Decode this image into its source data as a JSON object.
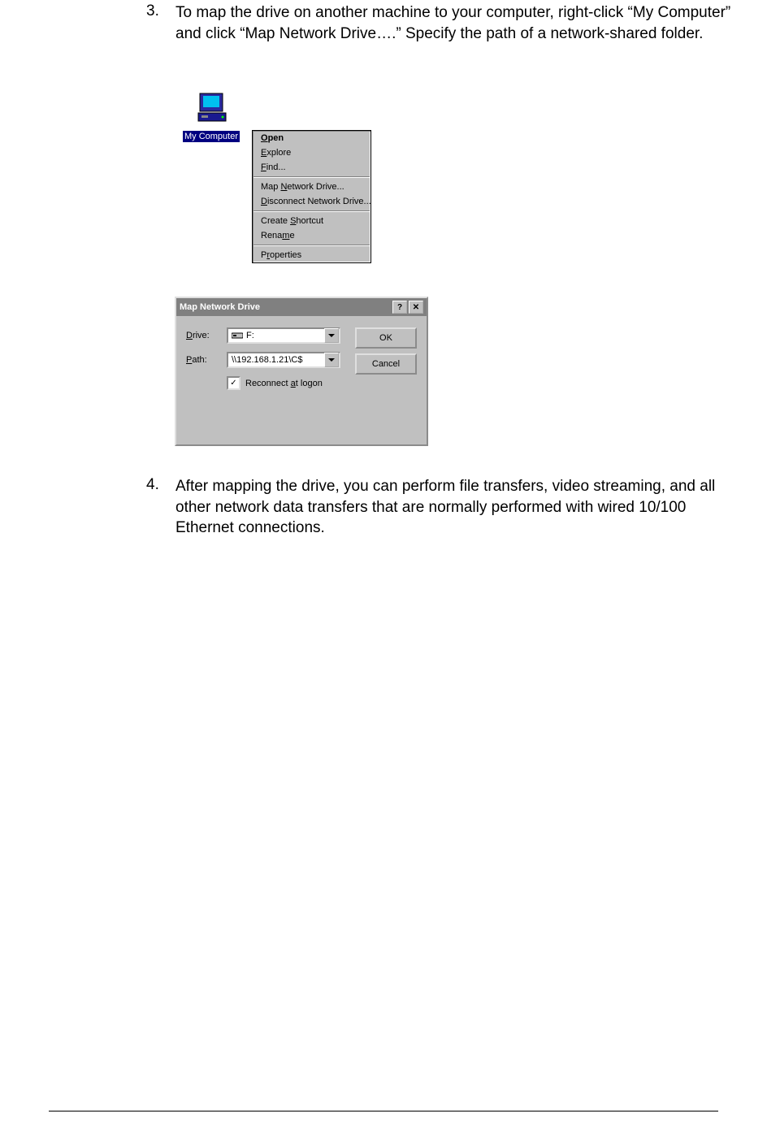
{
  "step3": {
    "num": "3.",
    "text": "To map the drive on another machine to your computer, right-click “My Computer” and click “Map Network Drive….” Specify the path of a network-shared folder."
  },
  "step4": {
    "num": "4.",
    "text": "After mapping the drive, you can perform file transfers, video streaming, and all other network data transfers that are normally performed with wired 10/100 Ethernet connections."
  },
  "my_computer_label": "My Computer",
  "context_menu": {
    "open": "Open",
    "explore": "Explore",
    "find": "Find...",
    "map": "Map Network Drive...",
    "disconnect": "Disconnect Network Drive...",
    "shortcut": "Create Shortcut",
    "rename": "Rename",
    "properties": "Properties",
    "mn": {
      "open": "O",
      "explore": "E",
      "find": "F",
      "map": "N",
      "disconnect": "D",
      "shortcut": "S",
      "rename": "m",
      "properties": "r"
    }
  },
  "dialog": {
    "title": "Map Network Drive",
    "help": "?",
    "close": "✕",
    "drive_label": "Drive:",
    "drive_mn": "D",
    "drive_value": "F:",
    "path_label": "Path:",
    "path_mn": "P",
    "path_value": "\\\\192.168.1.21\\C$",
    "reconnect": "Reconnect at logon",
    "reconnect_mn": "a",
    "reconnect_checked": "✓",
    "ok": "OK",
    "cancel": "Cancel"
  }
}
